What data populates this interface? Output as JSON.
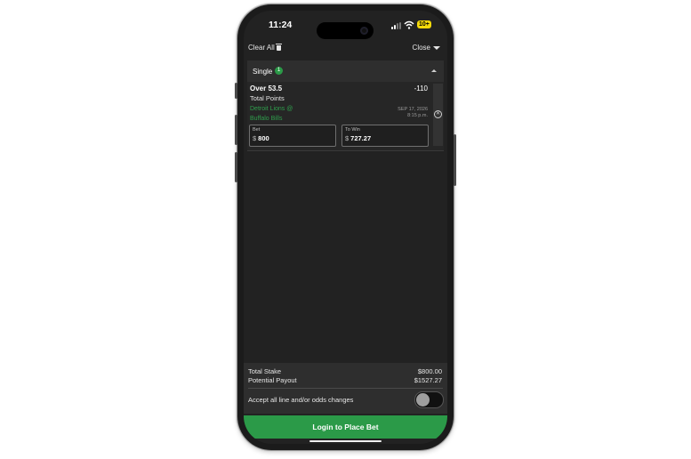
{
  "status_bar": {
    "time": "11:24",
    "battery": "10+"
  },
  "top_bar": {
    "clear_all_label": "Clear All",
    "close_label": "Close"
  },
  "betslip": {
    "section_label": "Single",
    "bet_count": "1",
    "bet": {
      "selection": "Over 53.5",
      "odds": "-110",
      "market": "Total Points",
      "event_line1": "Detroit Lions @",
      "event_line2": "Buffalo Bills",
      "date": "SEP 17, 2026",
      "time": "8:15 p.m.",
      "bet_field": {
        "label": "Bet",
        "currency": "$",
        "value": "800"
      },
      "to_win_field": {
        "label": "To Win",
        "currency": "$",
        "value": "727.27"
      }
    }
  },
  "summary": {
    "total_stake_label": "Total Stake",
    "total_stake_value": "$800.00",
    "potential_payout_label": "Potential Payout",
    "potential_payout_value": "$1527.27",
    "accept_changes_label": "Accept all line and/or odds changes",
    "accept_changes_enabled": false
  },
  "cta": {
    "label": "Login to Place Bet"
  },
  "colors": {
    "accent_green": "#2b9a48",
    "background": "#222222",
    "panel": "#2e2e2e"
  },
  "icons": [
    "trash-icon",
    "chevron-down-icon",
    "chevron-up-icon",
    "close-circle-icon",
    "wifi-icon",
    "signal-icon",
    "battery-icon"
  ]
}
